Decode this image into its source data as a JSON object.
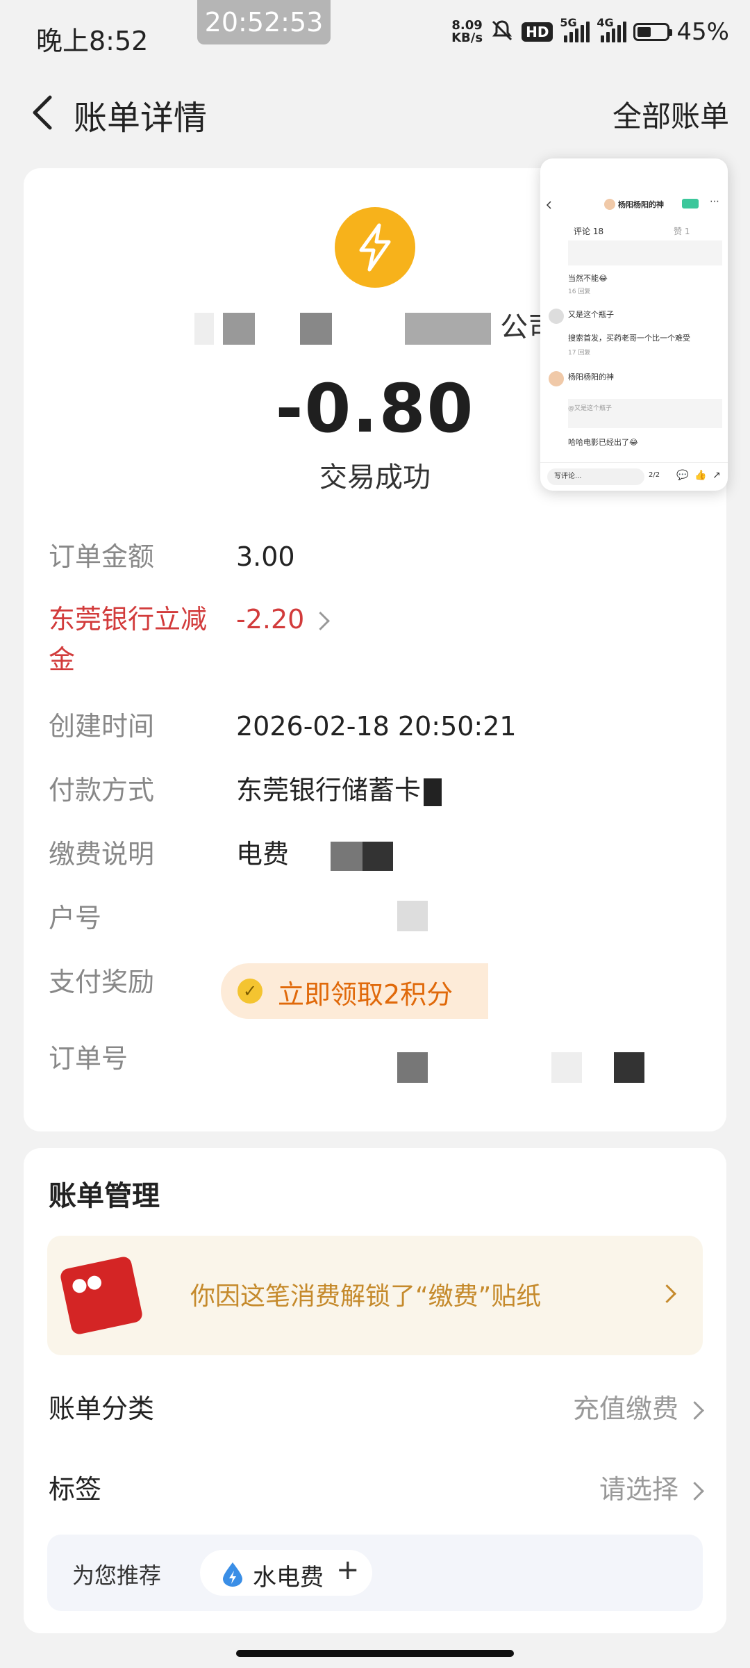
{
  "status_bar": {
    "time": "晚上8:52",
    "clock_overlay": "20:52:53",
    "net_speed_value": "8.09",
    "net_speed_unit": "KB/s",
    "hd": "HD",
    "sim1": "5G",
    "sim2": "4G",
    "battery": "45%"
  },
  "header": {
    "title": "账单详情",
    "all_bills": "全部账单"
  },
  "summary": {
    "merchant_suffix": "公司",
    "amount": "-0.80",
    "status": "交易成功"
  },
  "details": [
    {
      "label": "订单金额",
      "value": "3.00"
    },
    {
      "label": "东莞银行立减金",
      "value": "-2.20"
    },
    {
      "label": "创建时间",
      "value": "2026-02-18 20:50:21"
    },
    {
      "label": "付款方式",
      "value": "东莞银行储蓄卡"
    },
    {
      "label": "缴费说明",
      "value": "电费"
    },
    {
      "label": "户号",
      "value": ""
    },
    {
      "label": "支付奖励",
      "value": "立即领取2积分"
    },
    {
      "label": "订单号",
      "value": ""
    }
  ],
  "management": {
    "title": "账单管理",
    "sticker_text": "你因这笔消费解锁了“缴费”贴纸",
    "category_label": "账单分类",
    "category_value": "充值缴费",
    "tag_label": "标签",
    "tag_value": "请选择",
    "recommend_label": "为您推荐",
    "recommend_chip": "水电费",
    "recommend_plus": "+"
  },
  "pip": {
    "title": "杨阳杨阳的神",
    "tab_comments": "评论 18",
    "tab_likes": "赞 1",
    "c1": "当然不能😂",
    "c1_meta": "16  回复",
    "c2_user": "又是这个瓶子",
    "c2_text": "搜索首发，买药老哥一个比一个难受",
    "c2_meta": "17  回复",
    "c3_user": "杨阳杨阳的神",
    "c3_quote": "@又是这个瓶子",
    "c3_text": "哈哈电影已经出了😂",
    "input": "写评论...",
    "page": "2/2"
  },
  "colors": {
    "accent_red": "#d23b3b",
    "bolt_yellow": "#f7b21b",
    "reward_orange": "#e0690a",
    "sticker_gold": "#c58a2c"
  }
}
